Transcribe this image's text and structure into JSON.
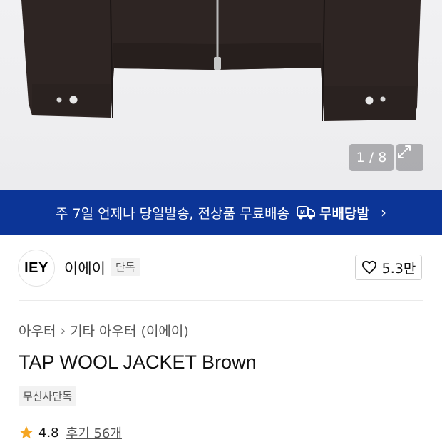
{
  "product_image": {
    "counter": "1 / 8"
  },
  "shipping_banner": {
    "text": "주 7일 언제나 당일발송, 전상품 무료배송",
    "brand_label": "무배당발",
    "accent_color": "#0c3597"
  },
  "brand": {
    "logo_text": "IEY",
    "name": "이에이",
    "exclusive_tag": "단독",
    "likes": "5.3만"
  },
  "breadcrumb": {
    "category": "아우터",
    "subcategory": "기타 아우터 (이에이)"
  },
  "product": {
    "title": "TAP WOOL JACKET Brown",
    "store_tag": "무신사단독",
    "rating": "4.8",
    "reviews": "후기 56개"
  }
}
